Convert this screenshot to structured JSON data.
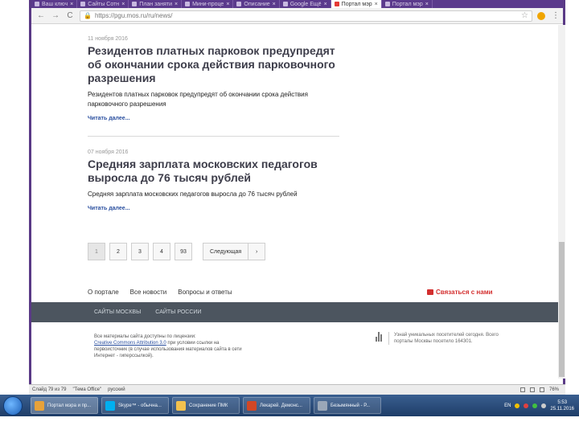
{
  "browser": {
    "tabs": [
      {
        "label": "Ваш ключ",
        "active": false
      },
      {
        "label": "Сайты Сотн",
        "active": false
      },
      {
        "label": "План заняти",
        "active": false
      },
      {
        "label": "Мини-проце",
        "active": false
      },
      {
        "label": "Описание",
        "active": false
      },
      {
        "label": "Google Ещё",
        "active": false
      },
      {
        "label": "Портал мэр",
        "active": true
      },
      {
        "label": "Портал мэр",
        "active": false
      }
    ],
    "url": "https://pgu.mos.ru/ru/news/",
    "back_icon": "back-arrow-icon",
    "forward_icon": "forward-arrow-icon",
    "reload_icon": "reload-icon"
  },
  "news": [
    {
      "date": "11 ноября 2016",
      "title": "Резидентов платных парковок предупредят об окончании срока действия парковочного разрешения",
      "lead": "Резидентов платных парковок предупредят об окончании срока действия парковочного разрешения",
      "more": "Читать далее..."
    },
    {
      "date": "07 ноября 2016",
      "title": "Средняя зарплата московских педагогов выросла до 76 тысяч рублей",
      "lead": "Средняя зарплата московских педагогов выросла до 76 тысяч рублей",
      "more": "Читать далее..."
    }
  ],
  "pagination": {
    "pages": [
      "1",
      "2",
      "3",
      "4",
      "93"
    ],
    "current": "1",
    "next_label": "Следующая",
    "arrow": "›"
  },
  "footer": {
    "links": [
      "О портале",
      "Все новости",
      "Вопросы и ответы"
    ],
    "contact": "Связаться с нами",
    "dark_links": [
      "САЙТЫ МОСКВЫ",
      "САЙТЫ РОССИИ"
    ],
    "license_1": "Все материалы сайта доступны по лицензии:",
    "license_link": "Creative Commons Attribution 3.0",
    "license_2": "при условии ссылки на первоисточник (в случае использования материалов сайта в сети Интернет - гиперссылкой).",
    "stats": "Узнай уникальных посетителей сегодня. Всего порталы Москвы посетило 164301."
  },
  "status": {
    "left": [
      "Слайд 79 из 79",
      "\"Тема Office\"",
      "русский"
    ],
    "zoom": "76%"
  },
  "taskbar": {
    "items": [
      {
        "label": "Портал мэра и пр...",
        "color": "#e8a23a"
      },
      {
        "label": "Skype™ - обычна...",
        "color": "#00aff0"
      },
      {
        "label": "Сохранение ПМК",
        "color": "#f2c14e"
      },
      {
        "label": "Лекарей. Демонс...",
        "color": "#d24726"
      },
      {
        "label": "Безымянный - Р...",
        "color": "#9aa7b8"
      }
    ],
    "lang": "EN",
    "time": "5:53",
    "date": "25.11.2016"
  }
}
